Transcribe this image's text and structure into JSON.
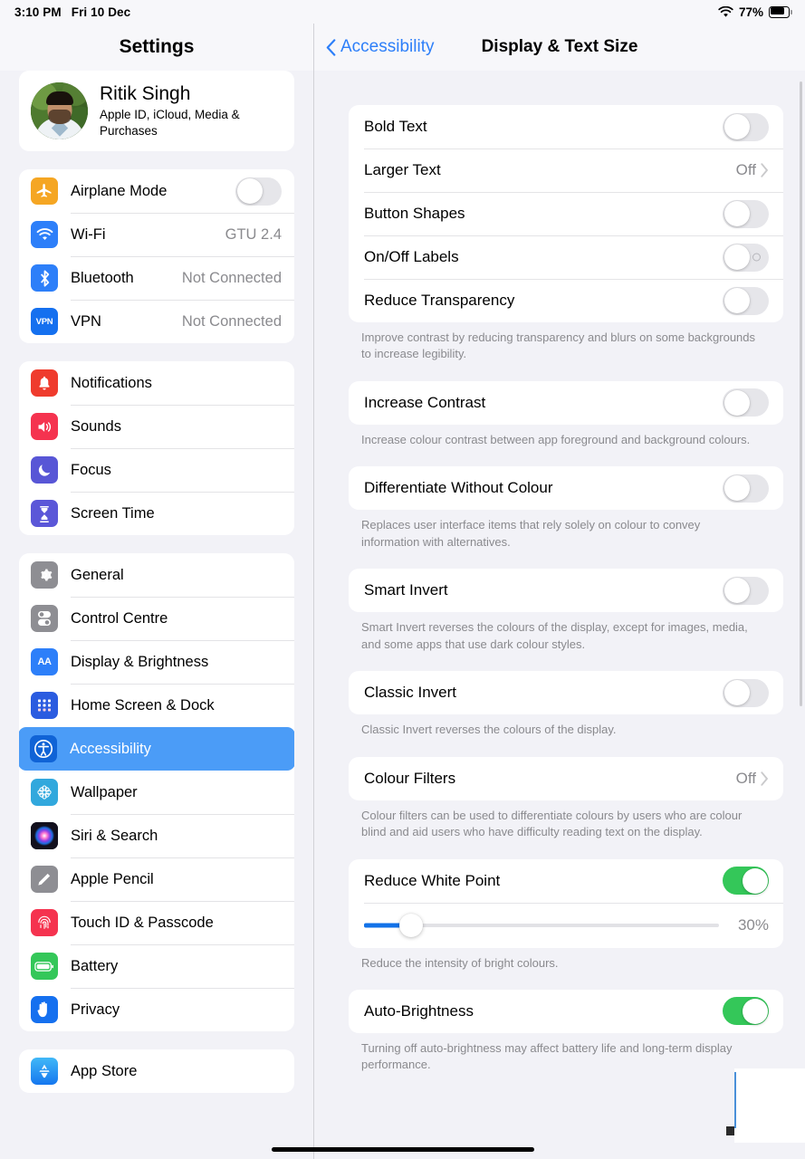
{
  "status_bar": {
    "time": "3:10 PM",
    "date": "Fri 10 Dec",
    "battery_percent": "77%",
    "wifi_icon": "wifi-icon",
    "battery_icon": "battery-icon",
    "battery_level": 77
  },
  "sidebar": {
    "title": "Settings",
    "account": {
      "name": "Ritik Singh",
      "subtitle": "Apple ID, iCloud, Media & Purchases",
      "avatar_icon": "avatar-photo"
    },
    "groups": [
      {
        "items": [
          {
            "label": "Airplane Mode",
            "icon": "airplane-icon",
            "icon_color": "#f5a623",
            "control": "toggle",
            "toggle_on": false
          },
          {
            "label": "Wi-Fi",
            "icon": "wifi-icon",
            "icon_color": "#2d7ff9",
            "value": "GTU 2.4"
          },
          {
            "label": "Bluetooth",
            "icon": "bluetooth-icon",
            "icon_color": "#2d7ff9",
            "value": "Not Connected"
          },
          {
            "label": "VPN",
            "icon": "vpn-icon",
            "icon_color": "#2d7ff9",
            "value": "Not Connected"
          }
        ]
      },
      {
        "items": [
          {
            "label": "Notifications",
            "icon": "notifications-bell-icon",
            "icon_color": "#ef3b2d"
          },
          {
            "label": "Sounds",
            "icon": "sounds-speaker-icon",
            "icon_color": "#f5334f"
          },
          {
            "label": "Focus",
            "icon": "focus-moon-icon",
            "icon_color": "#5856d6"
          },
          {
            "label": "Screen Time",
            "icon": "screen-time-hourglass-icon",
            "icon_color": "#5b57d8"
          }
        ]
      },
      {
        "items": [
          {
            "label": "General",
            "icon": "gear-icon",
            "icon_color": "#8e8e93"
          },
          {
            "label": "Control Centre",
            "icon": "control-centre-icon",
            "icon_color": "#8e8e93"
          },
          {
            "label": "Display & Brightness",
            "icon": "display-brightness-aa-icon",
            "icon_color": "#2d7ff9"
          },
          {
            "label": "Home Screen & Dock",
            "icon": "home-screen-dock-icon",
            "icon_color": "#2b5ce0"
          },
          {
            "label": "Accessibility",
            "icon": "accessibility-icon",
            "icon_color": "#1063d6",
            "selected": true
          },
          {
            "label": "Wallpaper",
            "icon": "wallpaper-flower-icon",
            "icon_color": "#31a8dd"
          },
          {
            "label": "Siri & Search",
            "icon": "siri-icon",
            "icon_color": "#1c1c2e"
          },
          {
            "label": "Apple Pencil",
            "icon": "apple-pencil-icon",
            "icon_color": "#8e8e93"
          },
          {
            "label": "Touch ID & Passcode",
            "icon": "touch-id-fingerprint-icon",
            "icon_color": "#f5334f"
          },
          {
            "label": "Battery",
            "icon": "battery-icon",
            "icon_color": "#34c759"
          },
          {
            "label": "Privacy",
            "icon": "privacy-hand-icon",
            "icon_color": "#1570ef"
          }
        ]
      },
      {
        "items": [
          {
            "label": "App Store",
            "icon": "app-store-icon",
            "icon_color": "#2d9cf5"
          }
        ]
      }
    ]
  },
  "detail": {
    "back_label": "Accessibility",
    "back_icon": "chevron-left-icon",
    "title": "Display & Text Size",
    "sections": [
      {
        "rows": [
          {
            "label": "Bold Text",
            "control": "toggle",
            "toggle_on": false
          },
          {
            "label": "Larger Text",
            "control": "disclosure",
            "value": "Off",
            "icon": "chevron-right-icon"
          },
          {
            "label": "Button Shapes",
            "control": "toggle",
            "toggle_on": false
          },
          {
            "label": "On/Off Labels",
            "control": "toggle",
            "toggle_on": false,
            "off_mark": true
          },
          {
            "label": "Reduce Transparency",
            "control": "toggle",
            "toggle_on": false
          }
        ],
        "footnote": "Improve contrast by reducing transparency and blurs on some backgrounds to increase legibility."
      },
      {
        "rows": [
          {
            "label": "Increase Contrast",
            "control": "toggle",
            "toggle_on": false
          }
        ],
        "footnote": "Increase colour contrast between app foreground and background colours."
      },
      {
        "rows": [
          {
            "label": "Differentiate Without Colour",
            "control": "toggle",
            "toggle_on": false
          }
        ],
        "footnote": "Replaces user interface items that rely solely on colour to convey information with alternatives."
      },
      {
        "rows": [
          {
            "label": "Smart Invert",
            "control": "toggle",
            "toggle_on": false
          }
        ],
        "footnote": "Smart Invert reverses the colours of the display, except for images, media, and some apps that use dark colour styles."
      },
      {
        "rows": [
          {
            "label": "Classic Invert",
            "control": "toggle",
            "toggle_on": false
          }
        ],
        "footnote": "Classic Invert reverses the colours of the display."
      },
      {
        "rows": [
          {
            "label": "Colour Filters",
            "control": "disclosure",
            "value": "Off",
            "icon": "chevron-right-icon"
          }
        ],
        "footnote": "Colour filters can be used to differentiate colours by users who are colour blind and aid users who have difficulty reading text on the display."
      },
      {
        "rows": [
          {
            "label": "Reduce White Point",
            "control": "toggle",
            "toggle_on": true
          },
          {
            "control": "slider",
            "slider_value": "30%",
            "slider_percent": 8
          }
        ],
        "footnote": "Reduce the intensity of bright colours."
      },
      {
        "rows": [
          {
            "label": "Auto-Brightness",
            "control": "toggle",
            "toggle_on": true
          }
        ],
        "footnote": "Turning off auto-brightness may affect battery life and long-term display performance."
      }
    ]
  },
  "colors": {
    "accent_blue": "#2d7ff9",
    "toggle_on_green": "#34c759",
    "selection_blue": "#4b9cf7",
    "slider_fill_blue": "#1272e8",
    "page_background": "#f2f2f7",
    "card_background": "#ffffff",
    "secondary_text": "#8a8a8e"
  }
}
